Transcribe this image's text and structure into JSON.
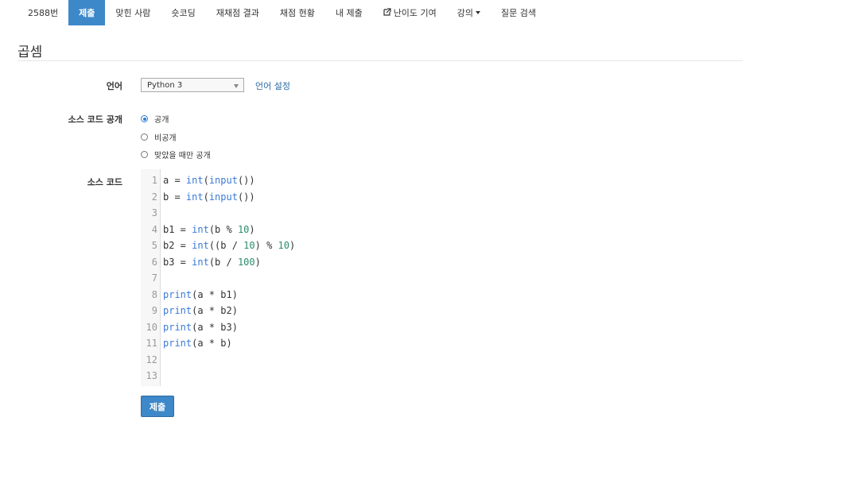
{
  "nav": {
    "items": [
      {
        "label": "2588번"
      },
      {
        "label": "제출"
      },
      {
        "label": "맞힌 사람"
      },
      {
        "label": "숏코딩"
      },
      {
        "label": "재채점 결과"
      },
      {
        "label": "채점 현황"
      },
      {
        "label": "내 제출"
      },
      {
        "label": "난이도 기여"
      },
      {
        "label": "강의"
      },
      {
        "label": "질문 검색"
      }
    ],
    "active_index": 1
  },
  "page": {
    "title": "곱셈"
  },
  "form": {
    "language_label": "언어",
    "language_value": "Python 3",
    "language_settings_link": "언어 설정",
    "visibility_label": "소스 코드 공개",
    "visibility_options": [
      "공개",
      "비공개",
      "맞았을 때만 공개"
    ],
    "visibility_selected": "공개",
    "source_label": "소스 코드",
    "submit_label": "제출"
  },
  "editor": {
    "lines": [
      "a = int(input())",
      "b = int(input())",
      "",
      "b1 = int(b % 10)",
      "b2 = int((b / 10) % 10)",
      "b3 = int(b / 100)",
      "",
      "print(a * b1)",
      "print(a * b2)",
      "print(a * b3)",
      "print(a * b)",
      "",
      ""
    ],
    "line_numbers": [
      "1",
      "2",
      "3",
      "4",
      "5",
      "6",
      "7",
      "8",
      "9",
      "10",
      "11",
      "12",
      "13"
    ]
  }
}
